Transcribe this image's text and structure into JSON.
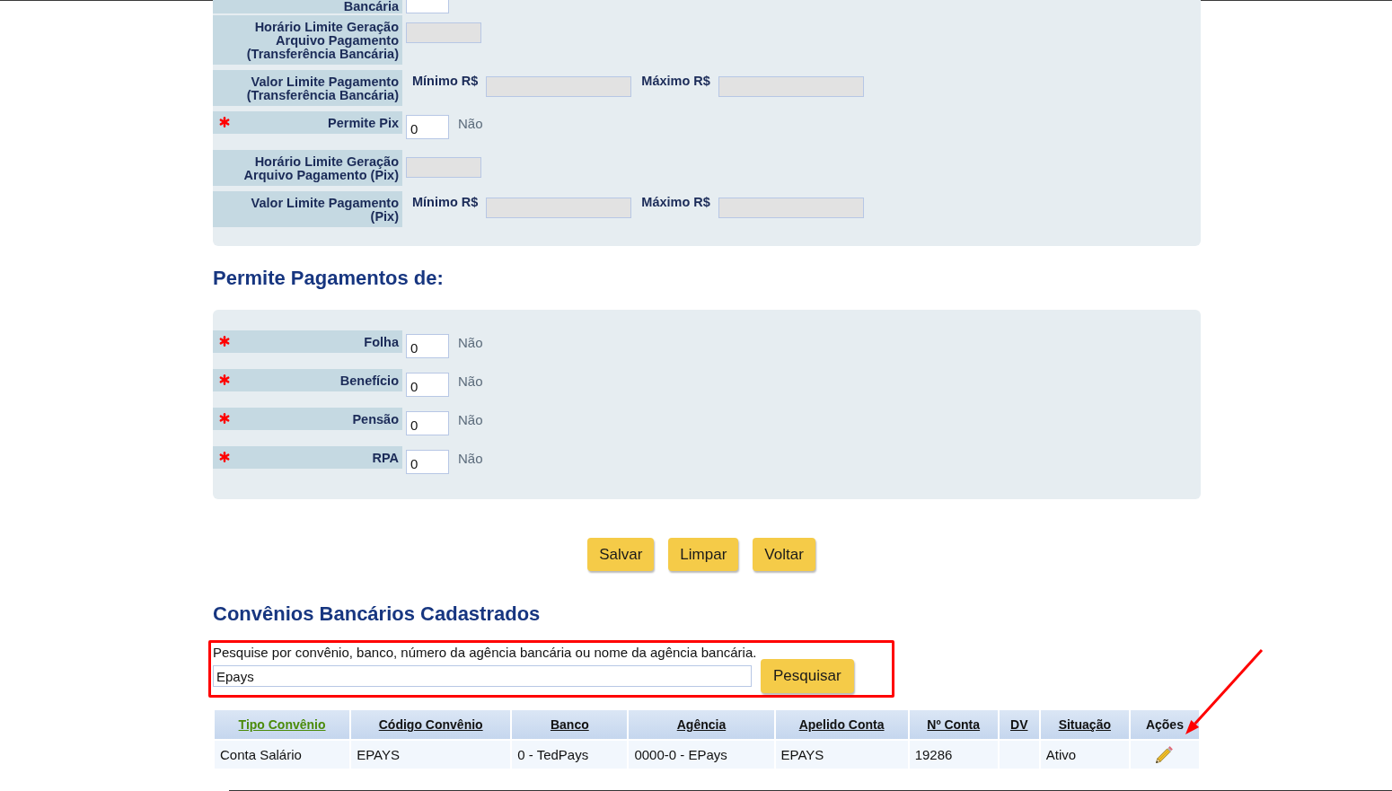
{
  "form_panel": {
    "rows": [
      {
        "kind": "toggle",
        "label": "Bancária",
        "required": false,
        "disabled": false
      },
      {
        "kind": "time",
        "label": "Horário Limite Geração Arquivo Pagamento (Transferência Bancária)",
        "required": false,
        "disabled": true
      },
      {
        "kind": "range",
        "label": "Valor Limite Pagamento (Transferência Bancária)",
        "required": false,
        "min_label": "Mínimo R$",
        "max_label": "Máximo R$",
        "disabled": true
      },
      {
        "kind": "toggle",
        "label": "Permite Pix",
        "required": true,
        "value": "0",
        "answer": "Não",
        "disabled": false
      },
      {
        "kind": "time",
        "label": "Horário Limite Geração Arquivo Pagamento (Pix)",
        "required": false,
        "disabled": true
      },
      {
        "kind": "range",
        "label": "Valor Limite Pagamento (Pix)",
        "required": false,
        "min_label": "Mínimo R$",
        "max_label": "Máximo R$",
        "disabled": true
      }
    ]
  },
  "payments_section": {
    "title": "Permite Pagamentos de:",
    "rows": [
      {
        "kind": "toggle",
        "label": "Folha",
        "required": true,
        "value": "0",
        "answer": "Não",
        "disabled": false
      },
      {
        "kind": "toggle",
        "label": "Benefício",
        "required": true,
        "value": "0",
        "answer": "Não",
        "disabled": false
      },
      {
        "kind": "toggle",
        "label": "Pensão",
        "required": true,
        "value": "0",
        "answer": "Não",
        "disabled": false
      },
      {
        "kind": "toggle",
        "label": "RPA",
        "required": true,
        "value": "0",
        "answer": "Não",
        "disabled": false
      }
    ]
  },
  "buttons": [
    "Salvar",
    "Limpar",
    "Voltar"
  ],
  "registered_section": {
    "title": "Convênios Bancários Cadastrados",
    "search": {
      "instructions": "Pesquise por convênio, banco, número da agência bancária ou nome da agência bancária.",
      "value": "Epays",
      "button": "Pesquisar"
    },
    "table": {
      "columns": [
        {
          "label": "Tipo Convênio",
          "sortable": true,
          "sorted": true
        },
        {
          "label": "Código Convênio",
          "sortable": true,
          "sorted": false
        },
        {
          "label": "Banco",
          "sortable": true,
          "sorted": false
        },
        {
          "label": "Agência",
          "sortable": true,
          "sorted": false
        },
        {
          "label": "Apelido Conta",
          "sortable": true,
          "sorted": false
        },
        {
          "label": "Nº Conta",
          "sortable": true,
          "sorted": false
        },
        {
          "label": "DV",
          "sortable": true,
          "sorted": false
        },
        {
          "label": "Situação",
          "sortable": true,
          "sorted": false
        },
        {
          "label": "Ações",
          "sortable": false,
          "sorted": false
        }
      ],
      "rows": [
        {
          "cells": [
            "Conta Salário",
            "EPAYS",
            "0 - TedPays",
            "0000-0 - EPays",
            "EPAYS",
            "19286",
            null,
            "Ativo"
          ],
          "actions": [
            {
              "kind": "edit"
            }
          ]
        }
      ]
    }
  },
  "annotations": {
    "search_frame": true,
    "arrow_to_actions": true
  }
}
